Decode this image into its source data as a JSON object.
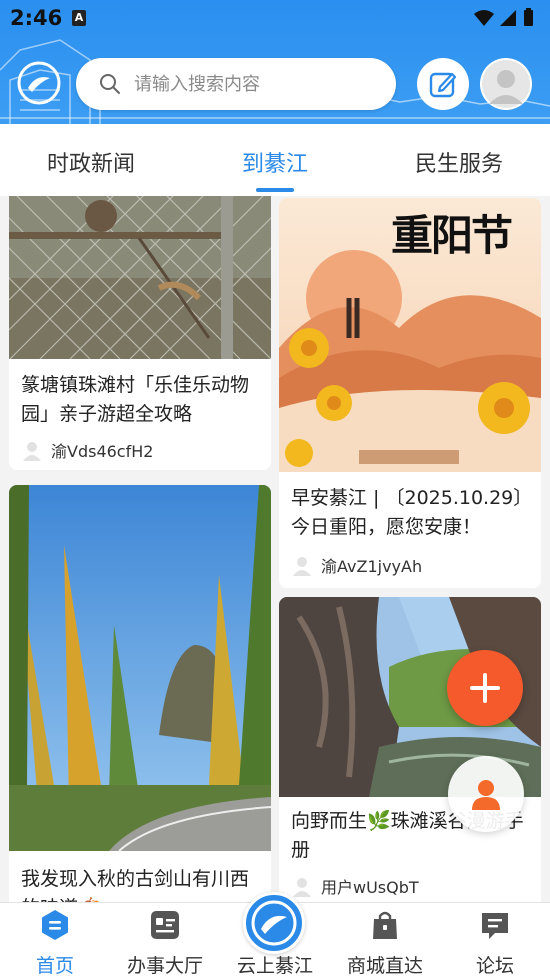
{
  "status_bar": {
    "time": "2:46",
    "notification_letter": "A"
  },
  "header": {
    "search_placeholder": "请输入搜索内容"
  },
  "tabs": [
    {
      "label": "时政新闻",
      "active": false
    },
    {
      "label": "到綦江",
      "active": true
    },
    {
      "label": "民生服务",
      "active": false
    }
  ],
  "feed": {
    "cards": [
      {
        "title": "篆塘镇珠滩村「乐佳乐动物园」亲子游超全攻略",
        "user": "渝Vds46cfH2",
        "image": "cage-photo"
      },
      {
        "title": "早安綦江 | 〔2025.10.29〕今日重阳，愿您安康！",
        "user": "渝AvZ1jvyAh",
        "image": "chongyang-poster",
        "poster_title": "重阳节"
      },
      {
        "title": "我发现入秋的古剑山有川西的味道🍂",
        "user": "",
        "image": "autumn-road-photo"
      },
      {
        "title": "向野而生🌿珠滩溪谷漫游手册",
        "user": "用户wUsQbT",
        "image": "canyon-photo"
      }
    ]
  },
  "bottom_nav": [
    {
      "label": "首页",
      "icon": "home-icon",
      "active": true
    },
    {
      "label": "办事大厅",
      "icon": "service-hall-icon",
      "active": false
    },
    {
      "label": "云上綦江",
      "icon": "qijiang-logo-icon",
      "active": false
    },
    {
      "label": "商城直达",
      "icon": "shopping-bag-icon",
      "active": false
    },
    {
      "label": "论坛",
      "icon": "forum-icon",
      "active": false
    }
  ],
  "colors": {
    "brand_blue": "#2b8ae8",
    "fab_orange": "#f45a2b",
    "person_orange": "#f46a2b"
  }
}
